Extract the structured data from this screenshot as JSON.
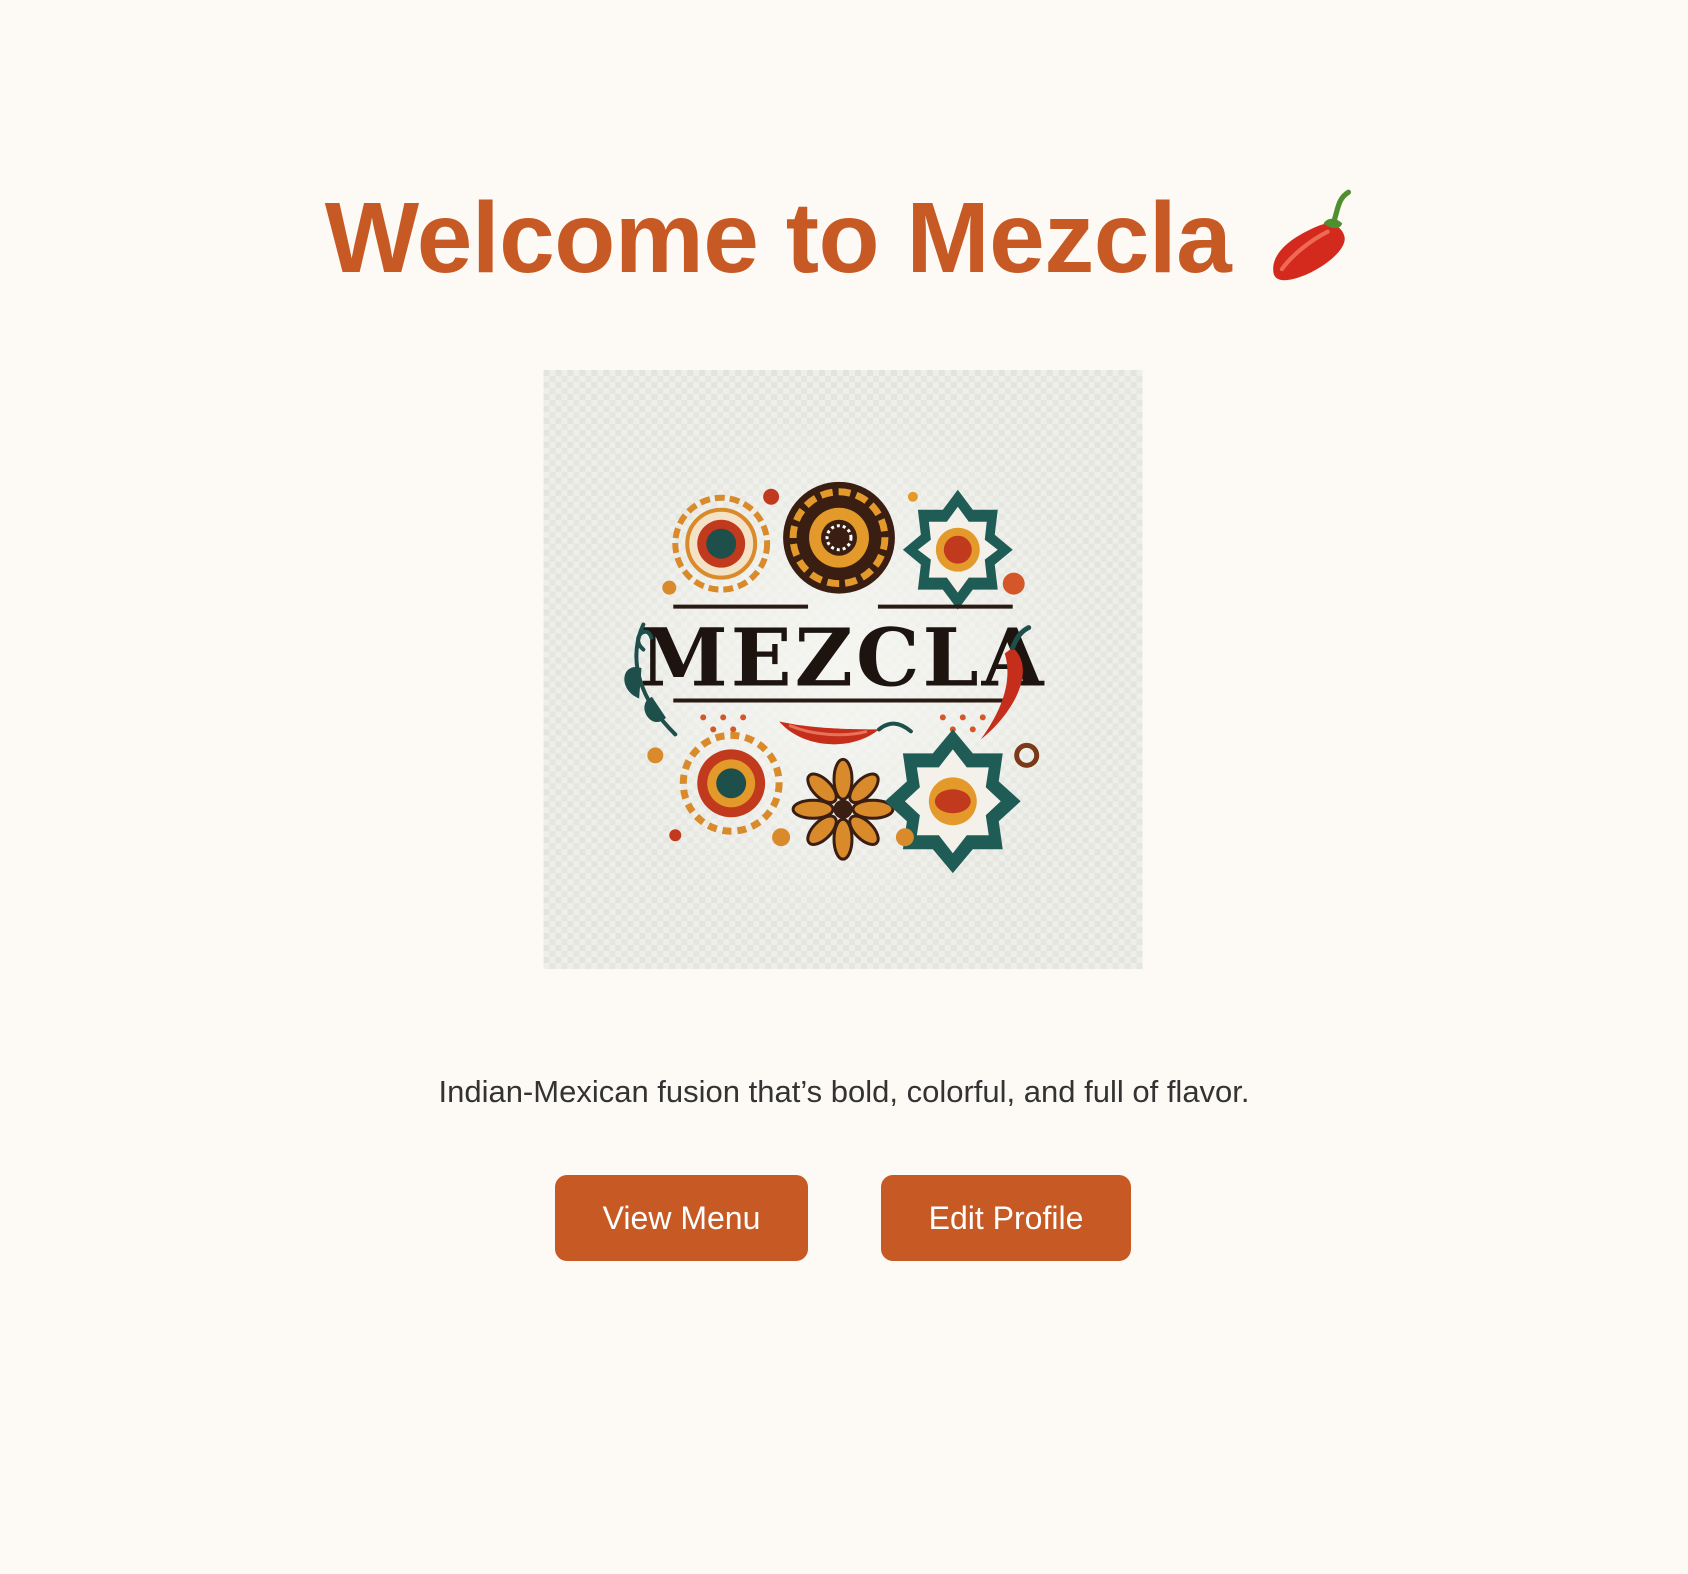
{
  "header": {
    "title": "Welcome to Mezcla",
    "title_icon": "chili-pepper-icon"
  },
  "logo": {
    "wordmark": "MEZCLA"
  },
  "tagline": "Indian-Mexican fusion that’s bold, colorful, and full of flavor.",
  "actions": {
    "view_menu_label": "View Menu",
    "edit_profile_label": "Edit Profile"
  },
  "colors": {
    "background": "#fdfaf5",
    "accent": "#c75a24",
    "text": "#333333",
    "button_text": "#ffffff"
  }
}
